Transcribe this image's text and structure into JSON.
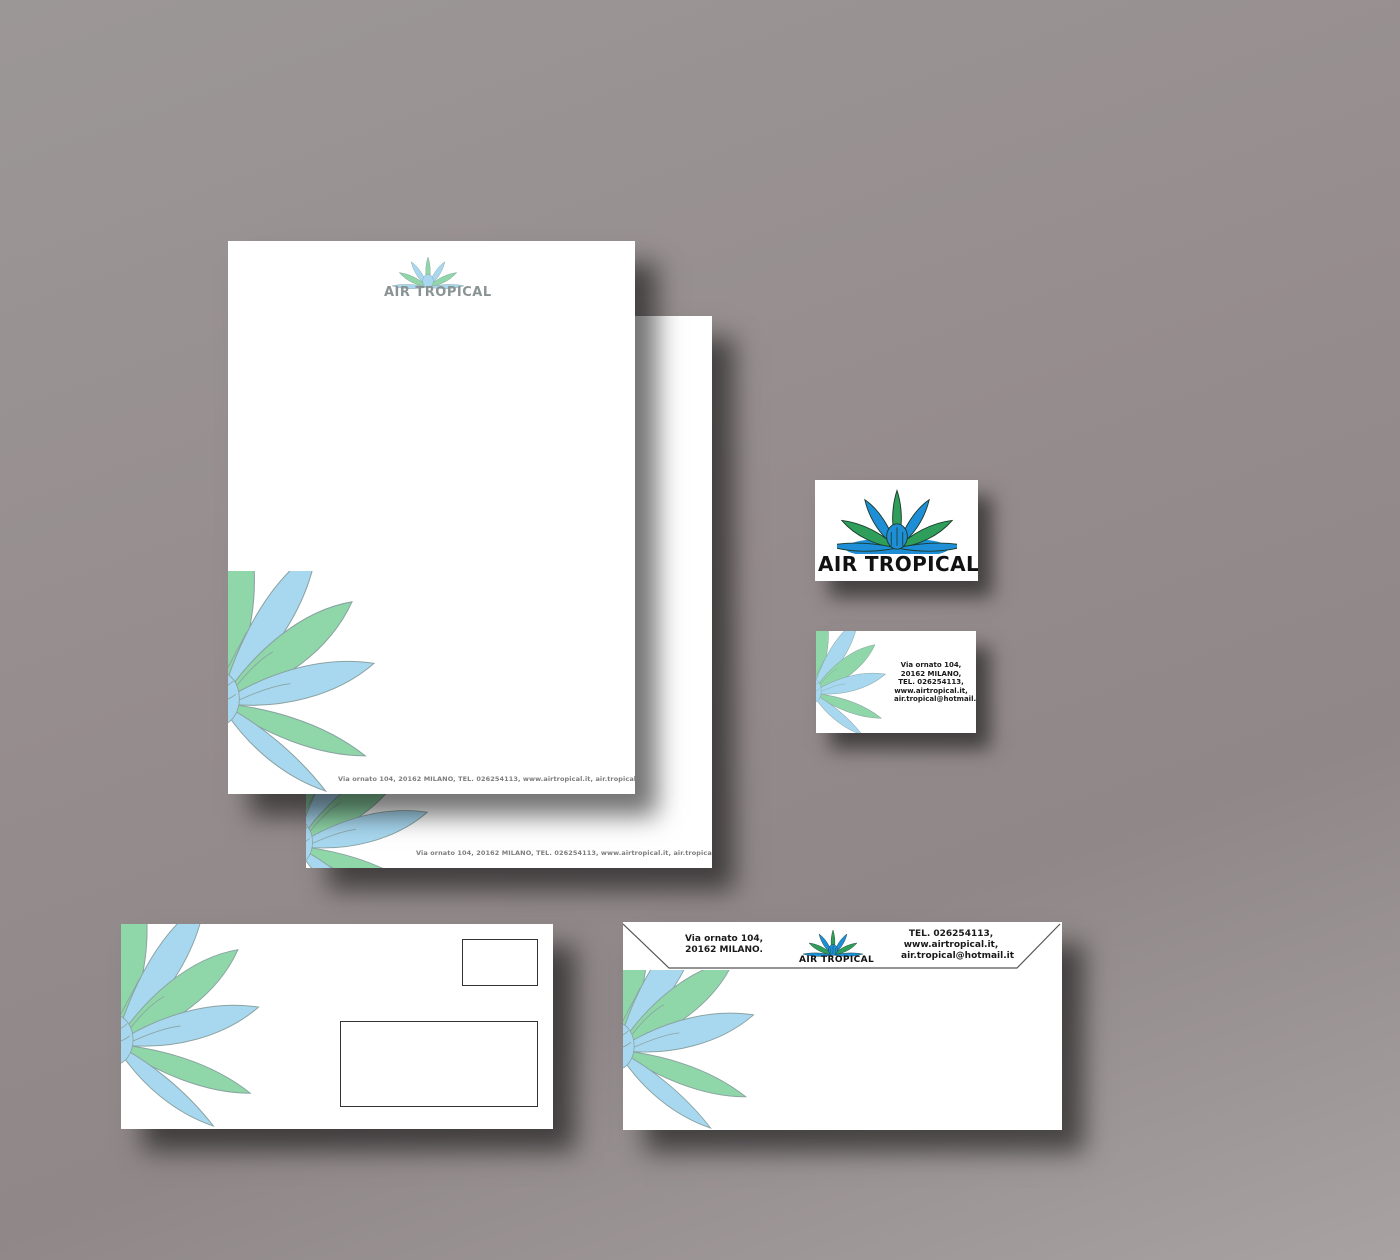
{
  "brand": {
    "name": "AIR TROPICAL",
    "colors": {
      "blue": "#a8d8f0",
      "green": "#8fd6a8",
      "outline": "#8aa3a3",
      "dark_blue": "#1e8fd6",
      "dark_green": "#2e9e5a",
      "background": "#958d8e",
      "paper": "#ffffff"
    }
  },
  "letterhead_front": {
    "logo_text": "AIR TROPICAL",
    "footer": "Via ornato 104, 20162 MILANO, TEL. 026254113, www.airtropical.it, air.tropical@hotmail.it"
  },
  "letterhead_back": {
    "footer": "Via ornato 104, 20162 MILANO, TEL. 026254113, www.airtropical.it, air.tropical@hotmail.it"
  },
  "business_card_front": {
    "logo_text": "AIR TROPICAL"
  },
  "business_card_back": {
    "lines": [
      "Via ornato 104,",
      "20162 MILANO,",
      "TEL. 026254113,",
      "www.airtropical.it,",
      "air.tropical@hotmail.it"
    ]
  },
  "envelope_front": {
    "stamp_box": "",
    "address_window": ""
  },
  "envelope_back": {
    "address_lines": [
      "Via ornato 104,",
      "20162 MILANO."
    ],
    "logo_text": "AIR TROPICAL",
    "contact_lines": [
      "TEL. 026254113,",
      "www.airtropical.it,",
      "air.tropical@hotmail.it"
    ]
  }
}
